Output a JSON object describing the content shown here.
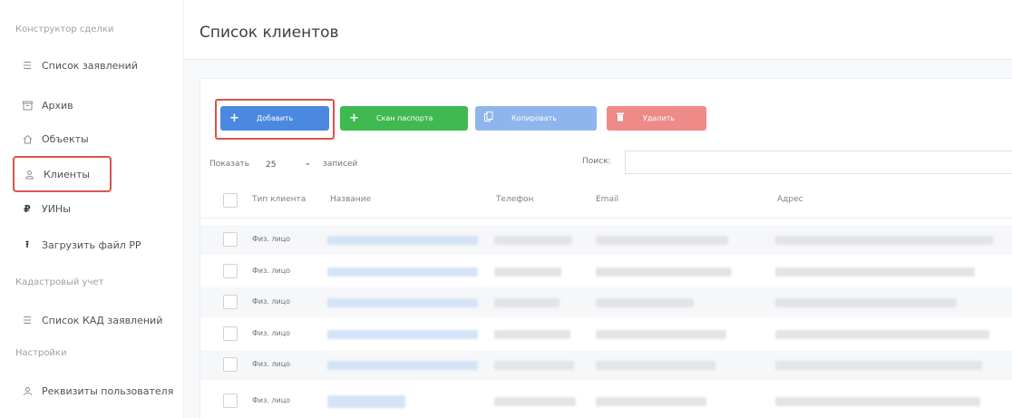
{
  "sidebar": {
    "sections": [
      {
        "label": "Конструктор сделки"
      },
      {
        "label": "Кадастровый учет"
      },
      {
        "label": "Настройки"
      }
    ],
    "items": [
      {
        "label": "Список заявлений",
        "icon": "list-icon"
      },
      {
        "label": "Архив",
        "icon": "archive-icon"
      },
      {
        "label": "Объекты",
        "icon": "home-icon"
      },
      {
        "label": "Клиенты",
        "icon": "clients-icon"
      },
      {
        "label": "УИНы",
        "icon": "ruble-icon"
      },
      {
        "label": "Загрузить файл РР",
        "icon": "upload-icon"
      },
      {
        "label": "Список КАД заявлений",
        "icon": "list-icon"
      },
      {
        "label": "Реквизиты пользователя",
        "icon": "user-icon"
      }
    ]
  },
  "header": {
    "title": "Список клиентов"
  },
  "toolbar": {
    "add_label": "Добавить",
    "scan_label": "Скан паспорта",
    "copy_label": "Копировать",
    "delete_label": "Удалить"
  },
  "controls": {
    "show_label": "Показать",
    "page_length": "25",
    "records_label": "записей",
    "search_label": "Поиск:"
  },
  "table": {
    "columns": [
      "Тип клиента",
      "Название",
      "Телефон",
      "Email",
      "Адрес"
    ],
    "rows": [
      {
        "type": "Физ. лицо"
      },
      {
        "type": "Физ. лицо"
      },
      {
        "type": "Физ. лицо"
      },
      {
        "type": "Физ. лицо"
      },
      {
        "type": "Физ. лицо"
      },
      {
        "type": "Физ. лицо"
      }
    ]
  },
  "colors": {
    "primary": "#4b88e0",
    "success": "#3fb950",
    "info": "#8fb6ec",
    "danger": "#ee8b89",
    "highlight": "#d9534f"
  }
}
